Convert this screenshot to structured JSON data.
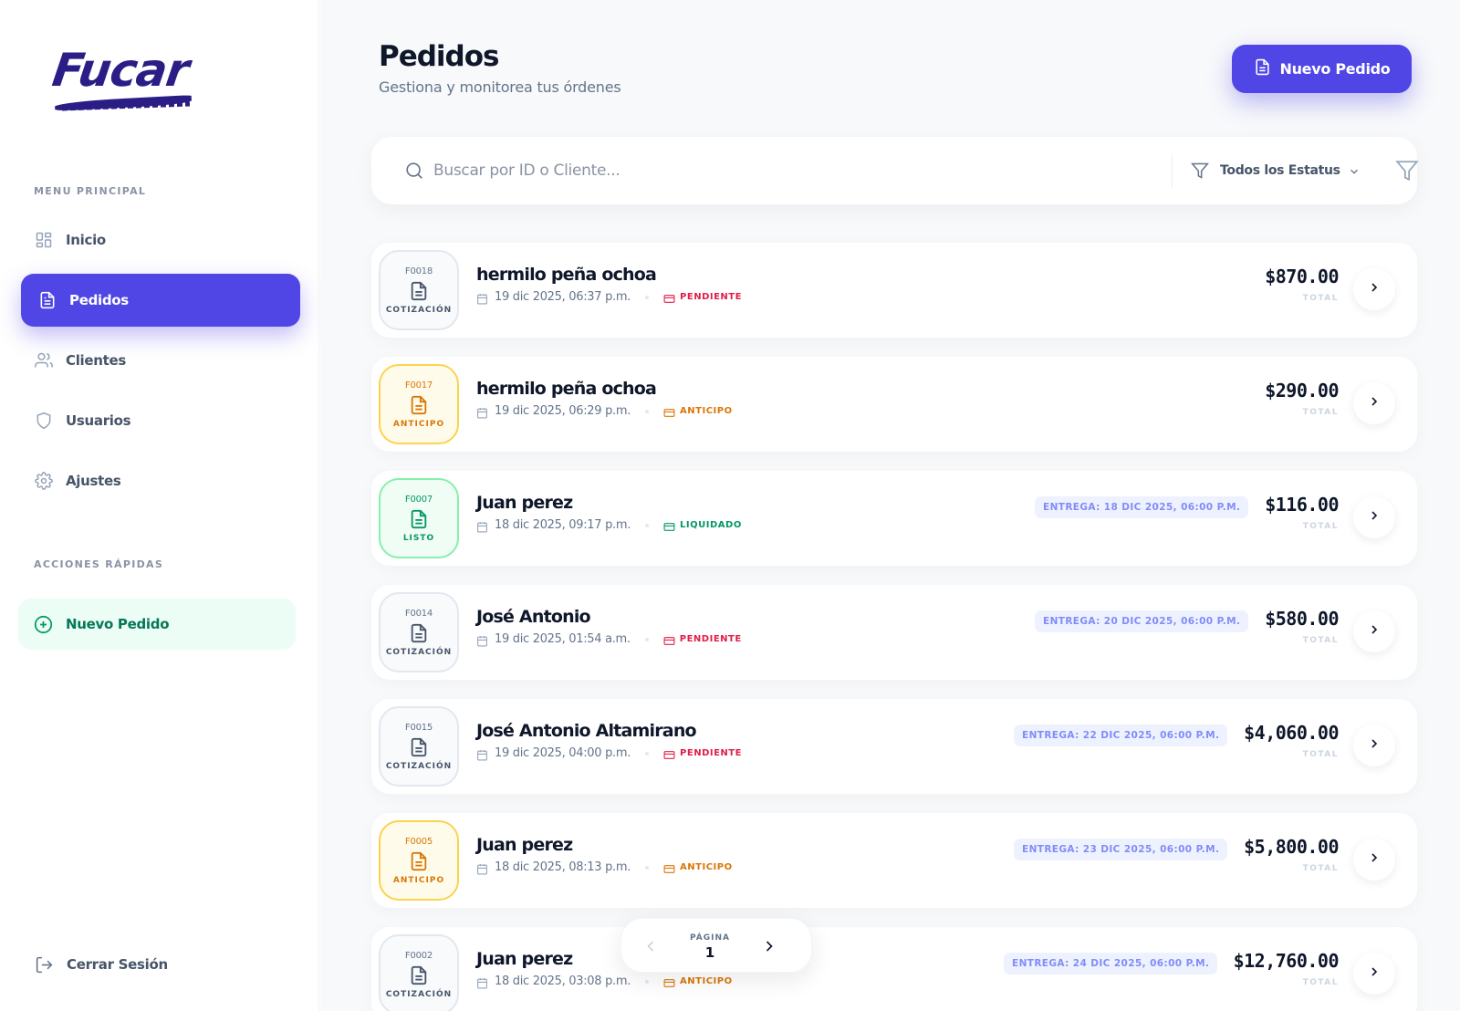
{
  "brand": {
    "logo_text": "Fucar",
    "accent": "#4f46e5"
  },
  "sidebar": {
    "menu_title": "MENU PRINCIPAL",
    "items": [
      {
        "label": "Inicio",
        "icon": "grid-icon"
      },
      {
        "label": "Pedidos",
        "icon": "document-icon",
        "active": true
      },
      {
        "label": "Clientes",
        "icon": "users-icon"
      },
      {
        "label": "Usuarios",
        "icon": "shield-icon"
      },
      {
        "label": "Ajustes",
        "icon": "gear-icon"
      }
    ],
    "quick_title": "ACCIONES RÁPIDAS",
    "quick_action": {
      "label": "Nuevo Pedido",
      "icon": "plus-circle-icon"
    },
    "logout": {
      "label": "Cerrar Sesión",
      "icon": "logout-icon"
    }
  },
  "header": {
    "title": "Pedidos",
    "subtitle": "Gestiona y monitorea tus órdenes",
    "new_button": "Nuevo Pedido"
  },
  "search": {
    "placeholder": "Buscar por ID o Cliente...",
    "value": "",
    "status_filter": "Todos los Estatus"
  },
  "orders": [
    {
      "id": "F0018",
      "stage": "COTIZACIÓN",
      "stage_type": "cotizacion",
      "client": "hermilo peña ochoa",
      "date": "19 dic 2025, 06:37 p.m.",
      "payment": "PENDIENTE",
      "payment_type": "pend",
      "delivery": "",
      "amount": "$870.00",
      "total_label": "TOTAL"
    },
    {
      "id": "F0017",
      "stage": "ANTICIPO",
      "stage_type": "anticipo",
      "client": "hermilo peña ochoa",
      "date": "19 dic 2025, 06:29 p.m.",
      "payment": "ANTICIPO",
      "payment_type": "ant",
      "delivery": "",
      "amount": "$290.00",
      "total_label": "TOTAL"
    },
    {
      "id": "F0007",
      "stage": "LISTO",
      "stage_type": "listo",
      "client": "Juan perez",
      "date": "18 dic 2025, 09:17 p.m.",
      "payment": "LIQUIDADO",
      "payment_type": "liq",
      "delivery": "ENTREGA: 18 DIC 2025, 06:00 P.M.",
      "amount": "$116.00",
      "total_label": "TOTAL"
    },
    {
      "id": "F0014",
      "stage": "COTIZACIÓN",
      "stage_type": "cotizacion",
      "client": "José Antonio",
      "date": "19 dic 2025, 01:54 a.m.",
      "payment": "PENDIENTE",
      "payment_type": "pend",
      "delivery": "ENTREGA: 20 DIC 2025, 06:00 P.M.",
      "amount": "$580.00",
      "total_label": "TOTAL"
    },
    {
      "id": "F0015",
      "stage": "COTIZACIÓN",
      "stage_type": "cotizacion",
      "client": "José Antonio Altamirano",
      "date": "19 dic 2025, 04:00 p.m.",
      "payment": "PENDIENTE",
      "payment_type": "pend",
      "delivery": "ENTREGA: 22 DIC 2025, 06:00 P.M.",
      "amount": "$4,060.00",
      "total_label": "TOTAL"
    },
    {
      "id": "F0005",
      "stage": "ANTICIPO",
      "stage_type": "anticipo",
      "client": "Juan perez",
      "date": "18 dic 2025, 08:13 p.m.",
      "payment": "ANTICIPO",
      "payment_type": "ant",
      "delivery": "ENTREGA: 23 DIC 2025, 06:00 P.M.",
      "amount": "$5,800.00",
      "total_label": "TOTAL"
    },
    {
      "id": "F0002",
      "stage": "COTIZACIÓN",
      "stage_type": "cotizacion",
      "client": "Juan perez",
      "date": "18 dic 2025, 03:08 p.m.",
      "payment": "ANTICIPO",
      "payment_type": "ant",
      "delivery": "ENTREGA: 24 DIC 2025, 06:00 P.M.",
      "amount": "$12,760.00",
      "total_label": "TOTAL"
    }
  ],
  "pager": {
    "label": "PÁGINA",
    "page": "1"
  }
}
